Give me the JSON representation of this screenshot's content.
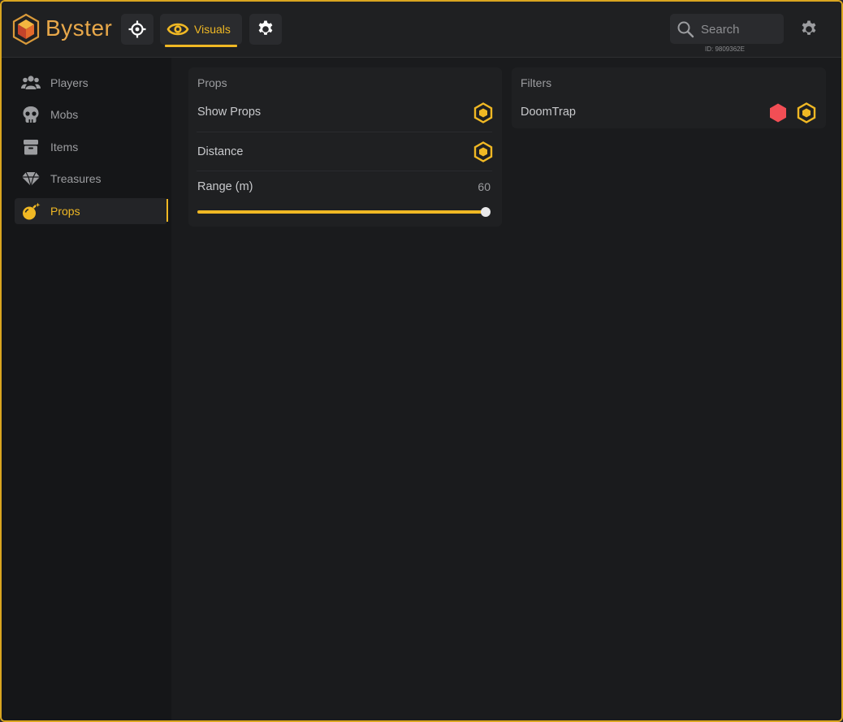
{
  "app": {
    "brand": "Byster",
    "id_text": "ID: 9809362E",
    "accent_color": "#f0b824",
    "brand_color": "#e8a84a"
  },
  "header": {
    "tabs": [
      {
        "icon": "crosshair-icon",
        "label": ""
      },
      {
        "icon": "eye-icon",
        "label": "Visuals",
        "active": true
      },
      {
        "icon": "gear-icon",
        "label": ""
      }
    ],
    "search": {
      "placeholder": "Search",
      "value": ""
    },
    "settings_icon": "gear-icon"
  },
  "sidebar": {
    "items": [
      {
        "label": "Players",
        "icon": "users-icon"
      },
      {
        "label": "Mobs",
        "icon": "skull-icon"
      },
      {
        "label": "Items",
        "icon": "box-icon"
      },
      {
        "label": "Treasures",
        "icon": "gem-icon"
      },
      {
        "label": "Props",
        "icon": "bomb-icon",
        "active": true
      }
    ]
  },
  "props_panel": {
    "title": "Props",
    "show_props": {
      "label": "Show Props",
      "enabled": true
    },
    "distance": {
      "label": "Distance",
      "enabled": true
    },
    "range": {
      "label": "Range (m)",
      "value": "60",
      "fill_fraction": 1.0
    }
  },
  "filters_panel": {
    "title": "Filters",
    "items": [
      {
        "label": "DoomTrap",
        "color_marker": "#f24e55",
        "enabled": true
      }
    ]
  }
}
